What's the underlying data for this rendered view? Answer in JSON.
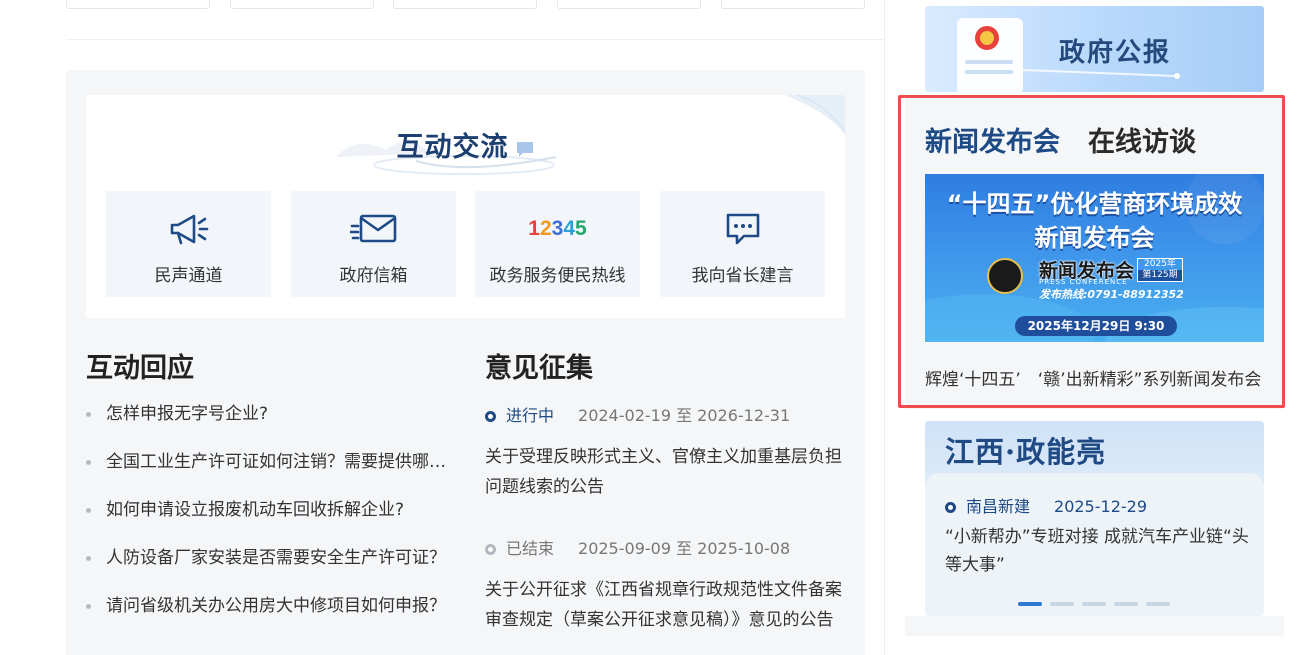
{
  "interaction": {
    "title": "互动交流",
    "channels": [
      {
        "label": "民声通道",
        "icon": "megaphone-icon"
      },
      {
        "label": "政府信箱",
        "icon": "mail-icon"
      },
      {
        "label": "政务服务便民热线",
        "icon": "hotline-12345-icon",
        "digits": [
          "1",
          "2",
          "3",
          "4",
          "5"
        ]
      },
      {
        "label": "我向省长建言",
        "icon": "chat-bubble-icon"
      }
    ]
  },
  "replies": {
    "title": "互动回应",
    "items": [
      "怎样申报无字号企业?",
      "全国工业生产许可证如何注销？需要提供哪些材料？",
      "如何申请设立报废机动车回收拆解企业?",
      "人防设备厂家安装是否需要安全生产许可证？",
      "请问省级机关办公用房大中修项目如何申报？"
    ]
  },
  "opinions": {
    "title": "意见征集",
    "items": [
      {
        "status": "进行中",
        "range": "2024-02-19 至 2026-12-31",
        "text": "关于受理反映形式主义、官僚主义加重基层负担问题线索的公告"
      },
      {
        "status": "已结束",
        "range": "2025-09-09 至 2025-10-08",
        "text": "关于公开征求《江西省规章行政规范性文件备案审查规定（草案公开征求意见稿）》意见的公告"
      }
    ]
  },
  "gov_bulletin": {
    "title": "政府公报"
  },
  "news": {
    "tabs": [
      "新闻发布会",
      "在线访谈"
    ],
    "image": {
      "line1": "“十四五”优化营商环境成效",
      "line2": "新闻发布会",
      "press": "新闻发布会",
      "year": "2025年",
      "issue": "第125期",
      "en": "PRESS CONFERENCE",
      "hotline": "发布热线:0791-88912352",
      "date": "2025年12月29日  9:30"
    },
    "caption": "辉煌‘十四五’　‘赣’出新精彩”系列新闻发布会"
  },
  "jiangxi": {
    "title": "江西·政能亮",
    "source": "南昌新建",
    "date": "2025-12-29",
    "text": "“小新帮办”专班对接 成就汽车产业链“头等大事”",
    "pages": 5,
    "active_page": 1
  },
  "colors": {
    "brand_blue": "#1e4a86",
    "highlight_red": "#ee4d4d",
    "panel_bg": "#f4f6f8",
    "digit_colors": [
      "#e8423f",
      "#f29a1e",
      "#3f6fd8",
      "#2aa0d8",
      "#23a86a"
    ]
  }
}
